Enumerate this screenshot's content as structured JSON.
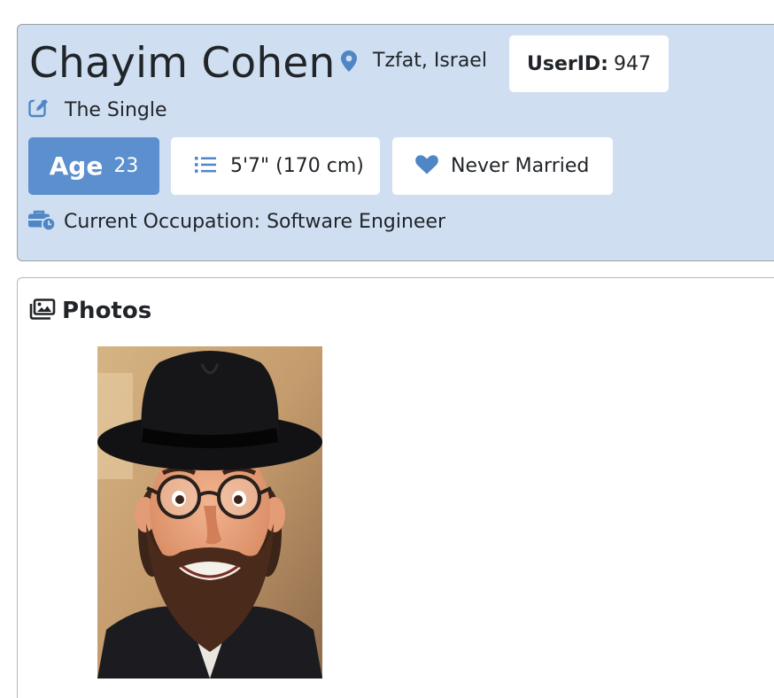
{
  "profile": {
    "name": "Chayim Cohen",
    "location": "Tzfat, Israel",
    "userid_label": "UserID:",
    "userid_value": "947",
    "tagline": "The Single",
    "age_label": "Age",
    "age_value": "23",
    "height": "5'7\" (170 cm)",
    "marital_status": "Never Married",
    "occupation": "Current Occupation: Software Engineer"
  },
  "photos": {
    "title": "Photos"
  },
  "icons": {
    "location": "map-marker-icon",
    "tagline": "edit-icon",
    "height": "list-icon",
    "status": "heart-icon",
    "occupation": "briefcase-clock-icon",
    "photos": "images-icon"
  },
  "colors": {
    "card_bg": "#cfdff1",
    "accent": "#5b8fce",
    "icon_blue": "#4f86c6"
  }
}
